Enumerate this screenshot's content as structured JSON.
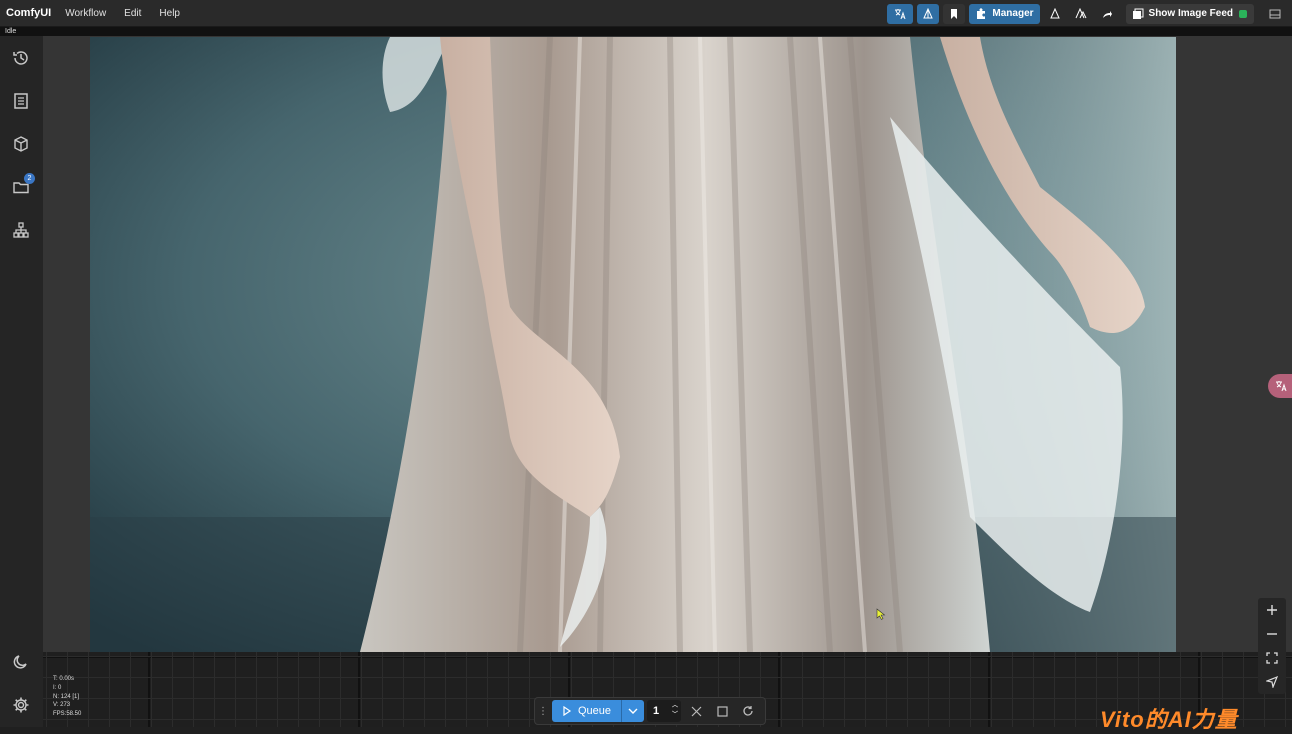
{
  "app": {
    "title": "ComfyUI"
  },
  "menu": [
    "Workflow",
    "Edit",
    "Help"
  ],
  "toolbar": {
    "manager_label": "Manager",
    "feed_label": "Show Image Feed"
  },
  "status": {
    "idle": "Idle"
  },
  "sidebar": {
    "items": [
      {
        "icon": "history-icon"
      },
      {
        "icon": "queue-list-icon"
      },
      {
        "icon": "model-library-icon"
      },
      {
        "icon": "folder-icon",
        "badge": "2"
      },
      {
        "icon": "node-tree-icon"
      }
    ],
    "bottom": [
      {
        "icon": "moon-icon"
      },
      {
        "icon": "gear-icon"
      }
    ]
  },
  "stats": [
    "T: 0.00s",
    "I: 0",
    "N: 124 [1]",
    "V: 273",
    "FPS:58.50"
  ],
  "queue": {
    "label": "Queue",
    "count": "1"
  },
  "watermark": "Vito的AI力量",
  "colors": {
    "accent": "#2f6ea3",
    "queue": "#3a8ddc"
  }
}
